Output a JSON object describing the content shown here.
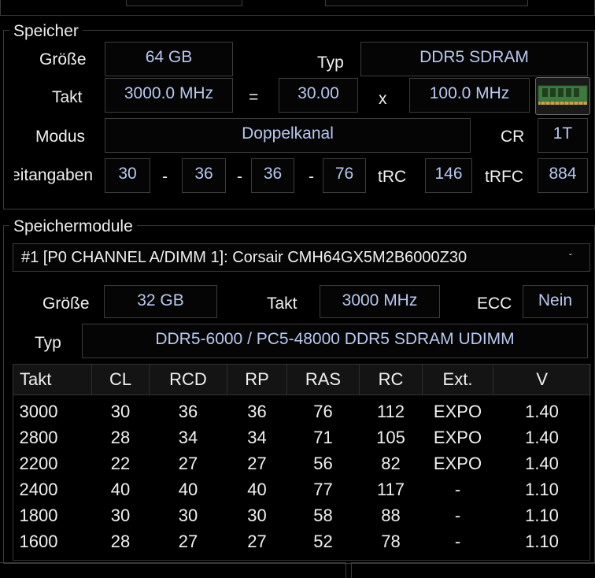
{
  "speicher": {
    "title": "Speicher",
    "groesse_label": "Größe",
    "groesse_value": "64 GB",
    "typ_label": "Typ",
    "typ_value": "DDR5 SDRAM",
    "takt_label": "Takt",
    "takt_value": "3000.0 MHz",
    "equals": "=",
    "multiplier": "30.00",
    "times": "x",
    "base_clock": "100.0 MHz",
    "modus_label": "Modus",
    "modus_value": "Doppelkanal",
    "cr_label": "CR",
    "cr_value": "1T",
    "zeitangaben_label": "Zeitangaben",
    "timing_1": "30",
    "timing_2": "36",
    "timing_3": "36",
    "timing_4": "76",
    "dash": "-",
    "trc_label": "tRC",
    "trc_value": "146",
    "trfc_label": "tRFC",
    "trfc_value": "884"
  },
  "module": {
    "title": "Speichermodule",
    "selected": "#1 [P0 CHANNEL A/DIMM 1]: Corsair CMH64GX5M2B6000Z30",
    "groesse_label": "Größe",
    "groesse_value": "32 GB",
    "takt_label": "Takt",
    "takt_value": "3000 MHz",
    "ecc_label": "ECC",
    "ecc_value": "Nein",
    "typ_label": "Typ",
    "typ_value": "DDR5-6000 / PC5-48000 DDR5 SDRAM UDIMM"
  },
  "timings_table": {
    "headers": [
      "Takt",
      "CL",
      "RCD",
      "RP",
      "RAS",
      "RC",
      "Ext.",
      "V"
    ],
    "rows": [
      [
        "3000",
        "30",
        "36",
        "36",
        "76",
        "112",
        "EXPO",
        "1.40"
      ],
      [
        "2800",
        "28",
        "34",
        "34",
        "71",
        "105",
        "EXPO",
        "1.40"
      ],
      [
        "2200",
        "22",
        "27",
        "27",
        "56",
        "82",
        "EXPO",
        "1.40"
      ],
      [
        "2400",
        "40",
        "40",
        "40",
        "77",
        "117",
        "-",
        "1.10"
      ],
      [
        "1800",
        "30",
        "30",
        "30",
        "58",
        "88",
        "-",
        "1.10"
      ],
      [
        "1600",
        "28",
        "27",
        "27",
        "52",
        "78",
        "-",
        "1.10"
      ]
    ]
  },
  "colors": {
    "background": "#000000",
    "value_text": "#b9c8ee",
    "label_text": "#f0f0f0",
    "border": "#3c3c3c"
  }
}
